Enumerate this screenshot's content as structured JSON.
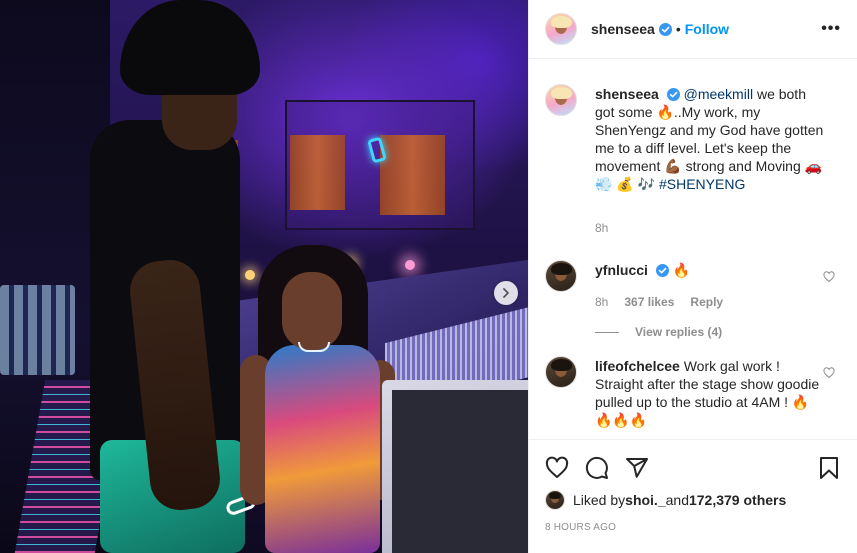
{
  "post": {
    "username": "shenseea",
    "follow_label": "Follow",
    "dot": "•",
    "more_label": "•••"
  },
  "caption": {
    "username": "shenseea",
    "mention": "@meekmill",
    "text_part1": " we both got some 🔥..My work, my ShenYengz and my God have gotten me to a diff level. Let's keep the movement 💪🏾 strong and Moving 🚗 💨 💰 🎶 ",
    "hashtag": "#SHENYENG",
    "time": "8h"
  },
  "comments": [
    {
      "username": "yfnlucci",
      "text": "🔥",
      "time": "8h",
      "likes": "367 likes",
      "reply_label": "Reply",
      "view_replies": "View replies (4)"
    },
    {
      "username": "lifeofchelcee",
      "text": "Work gal work ! Straight after the stage show goodie pulled up to the studio at 4AM ! 🔥🔥🔥🔥"
    }
  ],
  "likes": {
    "prefix": "Liked by ",
    "user": "shoi._",
    "middle": " and ",
    "count": "172,379 others"
  },
  "timestamp": "8 HOURS AGO",
  "icons": {
    "like": "heart-icon",
    "comment": "comment-icon",
    "share": "share-icon",
    "save": "bookmark-icon",
    "next": "chevron-right-icon",
    "verified": "verified-badge-icon"
  },
  "colors": {
    "accent": "#0095f6",
    "link": "#00376b",
    "muted": "#8e8e8e",
    "verified": "#3897f0"
  }
}
